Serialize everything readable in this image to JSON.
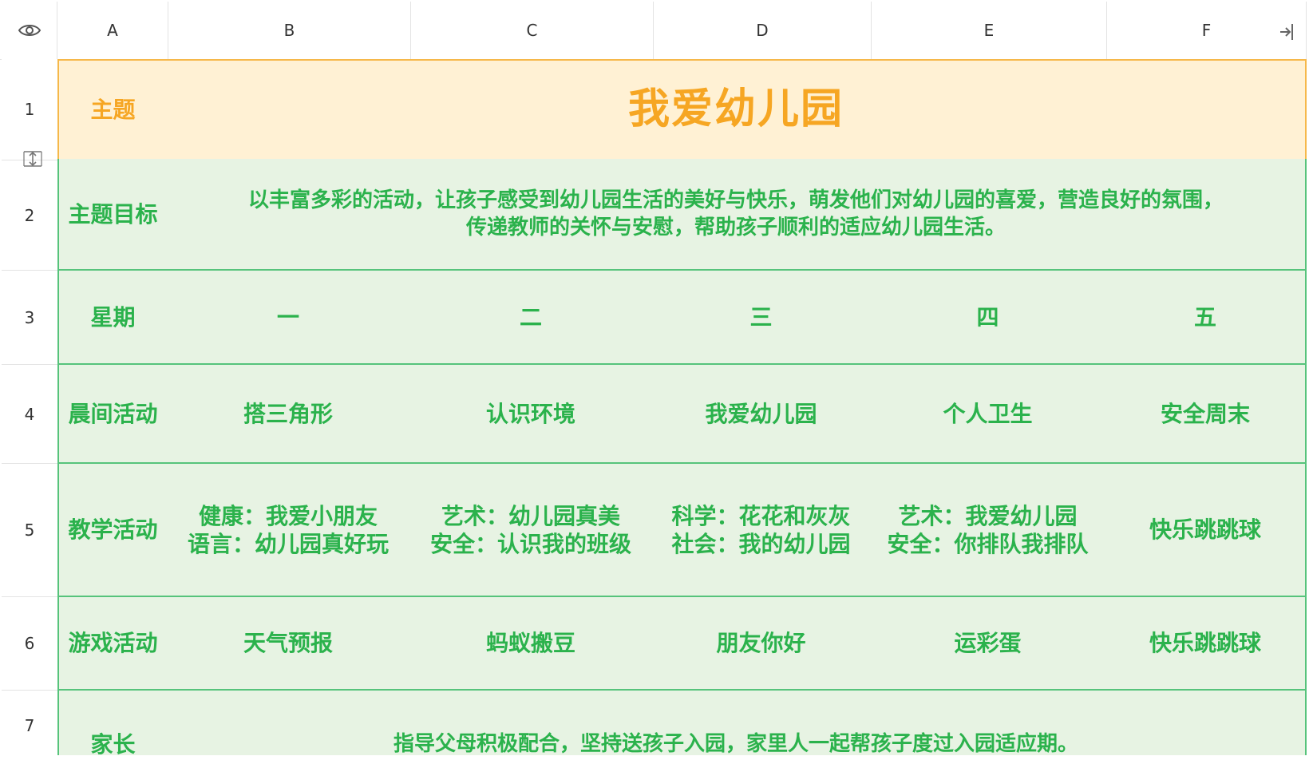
{
  "columns": [
    "A",
    "B",
    "C",
    "D",
    "E",
    "F"
  ],
  "rows": [
    "1",
    "2",
    "3",
    "4",
    "5",
    "6",
    "7"
  ],
  "sheet": {
    "r1": {
      "label": "主题",
      "title": "我爱幼儿园"
    },
    "r2": {
      "label": "主题目标",
      "text": "以丰富多彩的活动，让孩子感受到幼儿园生活的美好与快乐，萌发他们对幼儿园的喜爱，营造良好的氛围，\n传递教师的关怀与安慰，帮助孩子顺利的适应幼儿园生活。"
    },
    "r3": {
      "label": "星期",
      "cells": [
        "一",
        "二",
        "三",
        "四",
        "五"
      ]
    },
    "r4": {
      "label": "晨间活动",
      "cells": [
        "搭三角形",
        "认识环境",
        "我爱幼儿园",
        "个人卫生",
        "安全周末"
      ]
    },
    "r5": {
      "label": "教学活动",
      "cells": [
        "健康：我爱小朋友\n语言：幼儿园真好玩",
        "艺术：幼儿园真美\n安全：认识我的班级",
        "科学：花花和灰灰\n社会：我的幼儿园",
        "艺术：我爱幼儿园\n安全：你排队我排队",
        "快乐跳跳球"
      ]
    },
    "r6": {
      "label": "游戏活动",
      "cells": [
        "天气预报",
        "蚂蚁搬豆",
        "朋友你好",
        "运彩蛋",
        "快乐跳跳球"
      ]
    },
    "r7": {
      "label": "家长",
      "text": "指导父母积极配合，坚持送孩子入园，家里人一起帮孩子度过入园适应期。"
    }
  },
  "icons": {
    "visibility": "eye-icon",
    "collapse": "collapse-panel-icon",
    "row_resize": "row-resize-icon"
  },
  "colors": {
    "green_text": "#2bb24c",
    "green_bg": "#e7f3e3",
    "green_border": "#56c37b",
    "orange_text": "#f6a623",
    "orange_bg": "#fff1d4",
    "orange_border": "#f6b84a"
  }
}
